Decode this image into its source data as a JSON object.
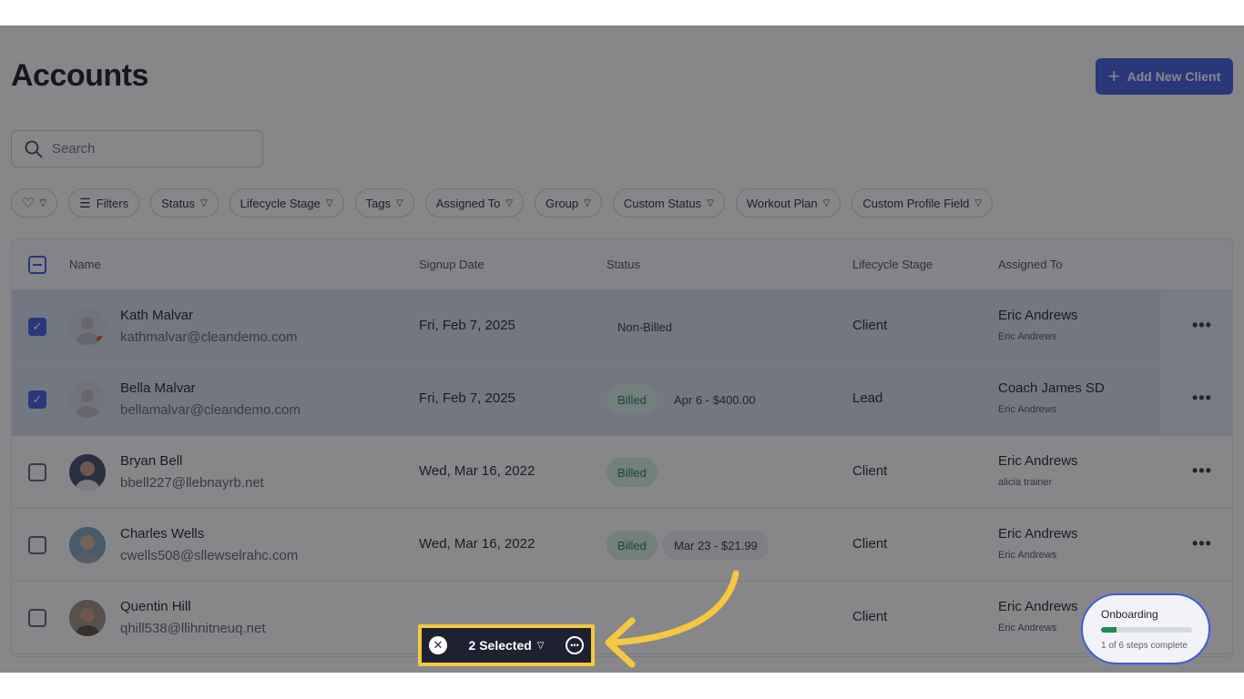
{
  "page": {
    "title": "Accounts",
    "add_button": "Add New Client"
  },
  "search": {
    "placeholder": "Search"
  },
  "filters": [
    "Filters",
    "Status",
    "Lifecycle Stage",
    "Tags",
    "Assigned To",
    "Group",
    "Custom Status",
    "Workout Plan",
    "Custom Profile Field"
  ],
  "columns": {
    "name": "Name",
    "signup": "Signup Date",
    "status": "Status",
    "stage": "Lifecycle Stage",
    "assigned": "Assigned To"
  },
  "rows": [
    {
      "name": "Kath Malvar",
      "email": "kathmalvar@cleandemo.com",
      "date": "Fri, Feb 7, 2025",
      "status": "Non-Billed",
      "extra": "",
      "stage": "Client",
      "assigned": "Eric Andrews",
      "assigned_sub": "Eric Andrews",
      "checked": true
    },
    {
      "name": "Bella Malvar",
      "email": "bellamalvar@cleandemo.com",
      "date": "Fri, Feb 7, 2025",
      "status": "Billed",
      "extra": "Apr 6 - $400.00",
      "stage": "Lead",
      "assigned": "Coach James SD",
      "assigned_sub": "Eric Andrews",
      "checked": true
    },
    {
      "name": "Bryan Bell",
      "email": "bbell227@llebnayrb.net",
      "date": "Wed, Mar 16, 2022",
      "status": "Billed",
      "extra": "",
      "stage": "Client",
      "assigned": "Eric Andrews",
      "assigned_sub": "alicia trainer",
      "checked": false
    },
    {
      "name": "Charles Wells",
      "email": "cwells508@sllewselrahc.com",
      "date": "Wed, Mar 16, 2022",
      "status": "Billed",
      "extra": "Mar 23 - $21.99",
      "stage": "Client",
      "assigned": "Eric Andrews",
      "assigned_sub": "Eric Andrews",
      "checked": false
    },
    {
      "name": "Quentin Hill",
      "email": "qhill538@llihnitneuq.net",
      "date": "",
      "status": "",
      "extra": "",
      "stage": "Client",
      "assigned": "Eric Andrews",
      "assigned_sub": "Eric Andrews",
      "checked": false
    }
  ],
  "bulk": {
    "label": "2 Selected"
  },
  "onboarding": {
    "title": "Onboarding",
    "progress": "1 of 6 steps complete",
    "progress_fraction": 0.167
  },
  "colors": {
    "accent": "#3b5bdb",
    "billed": "#1b7a52",
    "highlight": "#f5c842"
  }
}
